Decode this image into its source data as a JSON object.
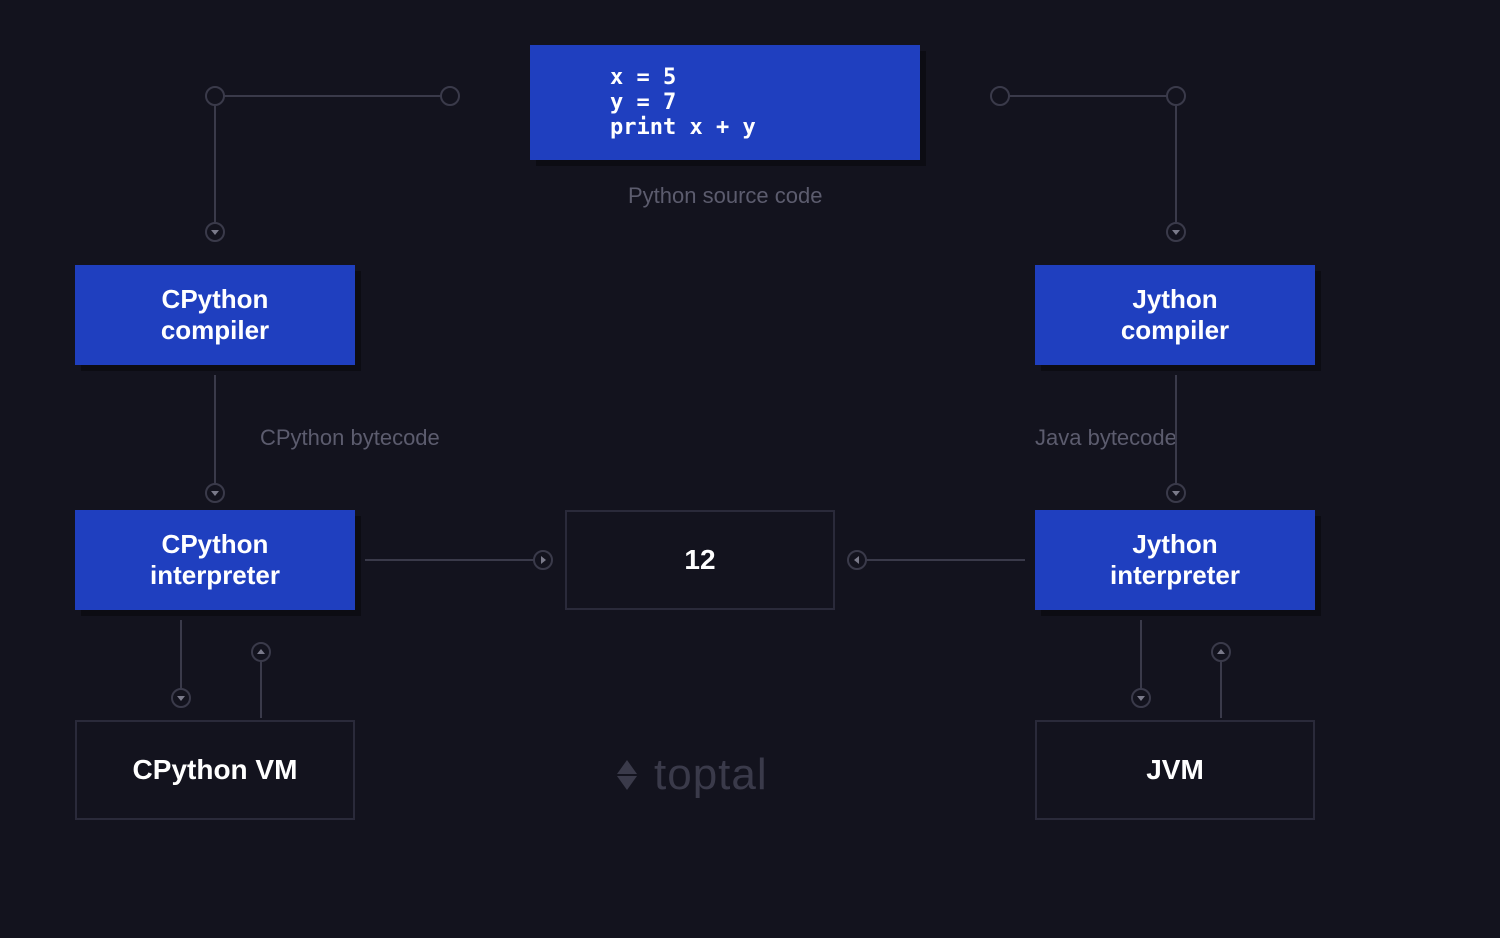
{
  "colors": {
    "background": "#13131e",
    "node_fill": "#1f3fbf",
    "outline": "#2a2a3a",
    "connector": "#3a3a4a",
    "label_text": "#5c5c6e",
    "node_text": "#ffffff"
  },
  "source": {
    "line1": "x = 5",
    "line2": "y = 7",
    "line3": "print x + y"
  },
  "labels": {
    "source": "Python source code",
    "cpython_bytecode": "CPython bytecode",
    "java_bytecode": "Java bytecode"
  },
  "nodes": {
    "cpython_compiler": "CPython compiler",
    "jython_compiler": "Jython compiler",
    "cpython_interpreter": "CPython interpreter",
    "jython_interpreter": "Jython interpreter",
    "output": "12",
    "cpython_vm": "CPython VM",
    "jvm": "JVM"
  },
  "brand": "toptal"
}
